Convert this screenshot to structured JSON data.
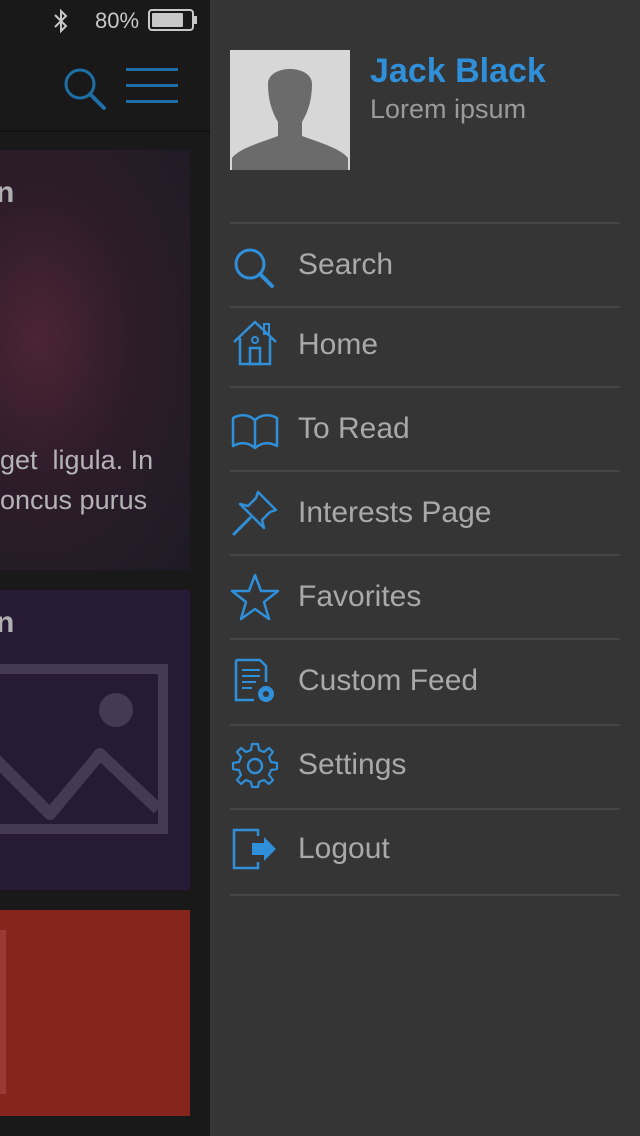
{
  "status_bar": {
    "battery_text": "80%",
    "battery_level_percent": 80
  },
  "background_feed": {
    "card1_title_fragment": "n",
    "card1_text_line1": "get  ligula. In",
    "card1_text_line2": "oncus purus",
    "card2_title_fragment": "n"
  },
  "profile": {
    "name": "Jack Black",
    "subtitle": "Lorem ipsum"
  },
  "menu": {
    "items": [
      {
        "label": "Search",
        "icon": "search-icon"
      },
      {
        "label": "Home",
        "icon": "home-icon"
      },
      {
        "label": "To Read",
        "icon": "book-icon"
      },
      {
        "label": "Interests Page",
        "icon": "pin-icon"
      },
      {
        "label": "Favorites",
        "icon": "star-icon"
      },
      {
        "label": "Custom Feed",
        "icon": "custom-feed-icon"
      },
      {
        "label": "Settings",
        "icon": "gear-icon"
      },
      {
        "label": "Logout",
        "icon": "logout-icon"
      }
    ]
  },
  "colors": {
    "accent": "#2f8fd8",
    "drawer_bg": "#353535",
    "card3_bg": "#86251c"
  }
}
